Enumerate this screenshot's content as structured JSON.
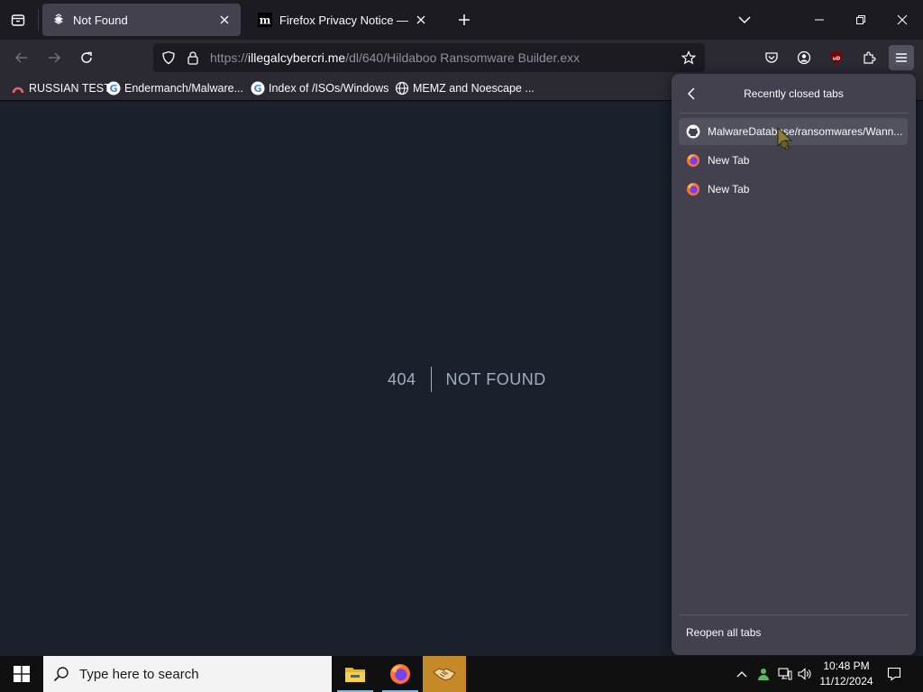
{
  "tabs": [
    {
      "title": "Not Found",
      "favicon": "laptop-stack-icon",
      "active": true
    },
    {
      "title": "Firefox Privacy Notice — Mozill",
      "favicon": "mozilla-m-icon",
      "active": false
    }
  ],
  "address_bar": {
    "url_prefix": "https://",
    "url_host": "illegalcybercri.me",
    "url_path": "/dl/640/Hildaboo Ransomware Builder.exx"
  },
  "bookmarks": [
    {
      "label": "RUSSIAN TEST",
      "icon": "arc-icon"
    },
    {
      "label": "Endermanch/Malware...",
      "icon": "google-icon"
    },
    {
      "label": "Index of /ISOs/Windows",
      "icon": "google-icon"
    },
    {
      "label": "MEMZ and Noescape ...",
      "icon": "globe-icon"
    }
  ],
  "page": {
    "code": "404",
    "message": "NOT FOUND"
  },
  "recently_closed": {
    "title": "Recently closed tabs",
    "items": [
      {
        "label": "MalwareDatabase/ransomwares/Wann...",
        "icon": "github-icon"
      },
      {
        "label": "New Tab",
        "icon": "firefox-icon"
      },
      {
        "label": "New Tab",
        "icon": "firefox-icon"
      }
    ],
    "reopen_all": "Reopen all tabs"
  },
  "taskbar": {
    "search_placeholder": "Type here to search",
    "time": "10:48 PM",
    "date": "11/12/2024"
  },
  "colors": {
    "page_bg": "#1a202c",
    "text_muted": "#a0aec0",
    "panel_bg": "#42414d",
    "taskbar_active": "#c58a27"
  }
}
